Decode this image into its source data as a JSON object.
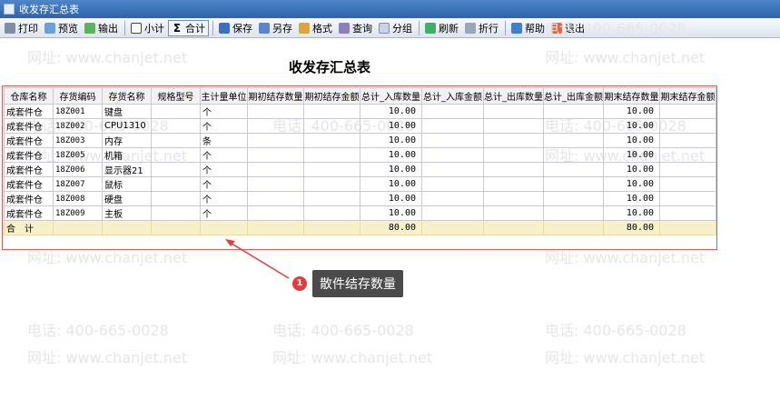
{
  "window": {
    "title": "收发存汇总表"
  },
  "toolbar": {
    "print": "打印",
    "preview": "预览",
    "export": "输出",
    "subtotal": "小计",
    "total": "合计",
    "save": "保存",
    "saveas": "另存",
    "format": "格式",
    "query": "查询",
    "group": "分组",
    "refresh": "刷新",
    "wrap": "折行",
    "help": "帮助",
    "exit": "退出"
  },
  "watermark": {
    "phone": "电话: 400-665-0028",
    "site": "网址: www.chanjet.net"
  },
  "report": {
    "title": "收发存汇总表",
    "columns": [
      "仓库名称",
      "存货编码",
      "存货名称",
      "规格型号",
      "主计量单位",
      "期初结存数量",
      "期初结存金额",
      "总计_入库数量",
      "总计_入库金额",
      "总计_出库数量",
      "总计_出库金额",
      "期末结存数量",
      "期末结存金额"
    ],
    "rows": [
      [
        "成套件仓",
        "18Z001",
        "键盘",
        "",
        "个",
        "",
        "",
        "10.00",
        "",
        "",
        "",
        "10.00",
        ""
      ],
      [
        "成套件仓",
        "18Z002",
        "CPU1310",
        "",
        "个",
        "",
        "",
        "10.00",
        "",
        "",
        "",
        "10.00",
        ""
      ],
      [
        "成套件仓",
        "18Z003",
        "内存",
        "",
        "条",
        "",
        "",
        "10.00",
        "",
        "",
        "",
        "10.00",
        ""
      ],
      [
        "成套件仓",
        "18Z005",
        "机箱",
        "",
        "个",
        "",
        "",
        "10.00",
        "",
        "",
        "",
        "10.00",
        ""
      ],
      [
        "成套件仓",
        "18Z006",
        "显示器21",
        "",
        "个",
        "",
        "",
        "10.00",
        "",
        "",
        "",
        "10.00",
        ""
      ],
      [
        "成套件仓",
        "18Z007",
        "鼠标",
        "",
        "个",
        "",
        "",
        "10.00",
        "",
        "",
        "",
        "10.00",
        ""
      ],
      [
        "成套件仓",
        "18Z008",
        "硬盘",
        "",
        "个",
        "",
        "",
        "10.00",
        "",
        "",
        "",
        "10.00",
        ""
      ],
      [
        "成套件仓",
        "18Z009",
        "主板",
        "",
        "个",
        "",
        "",
        "10.00",
        "",
        "",
        "",
        "10.00",
        ""
      ]
    ],
    "total_row": [
      "合　计",
      "",
      "",
      "",
      "",
      "",
      "",
      "80.00",
      "",
      "",
      "",
      "80.00",
      ""
    ]
  },
  "callout": {
    "number": "1",
    "text": "散件结存数量"
  }
}
